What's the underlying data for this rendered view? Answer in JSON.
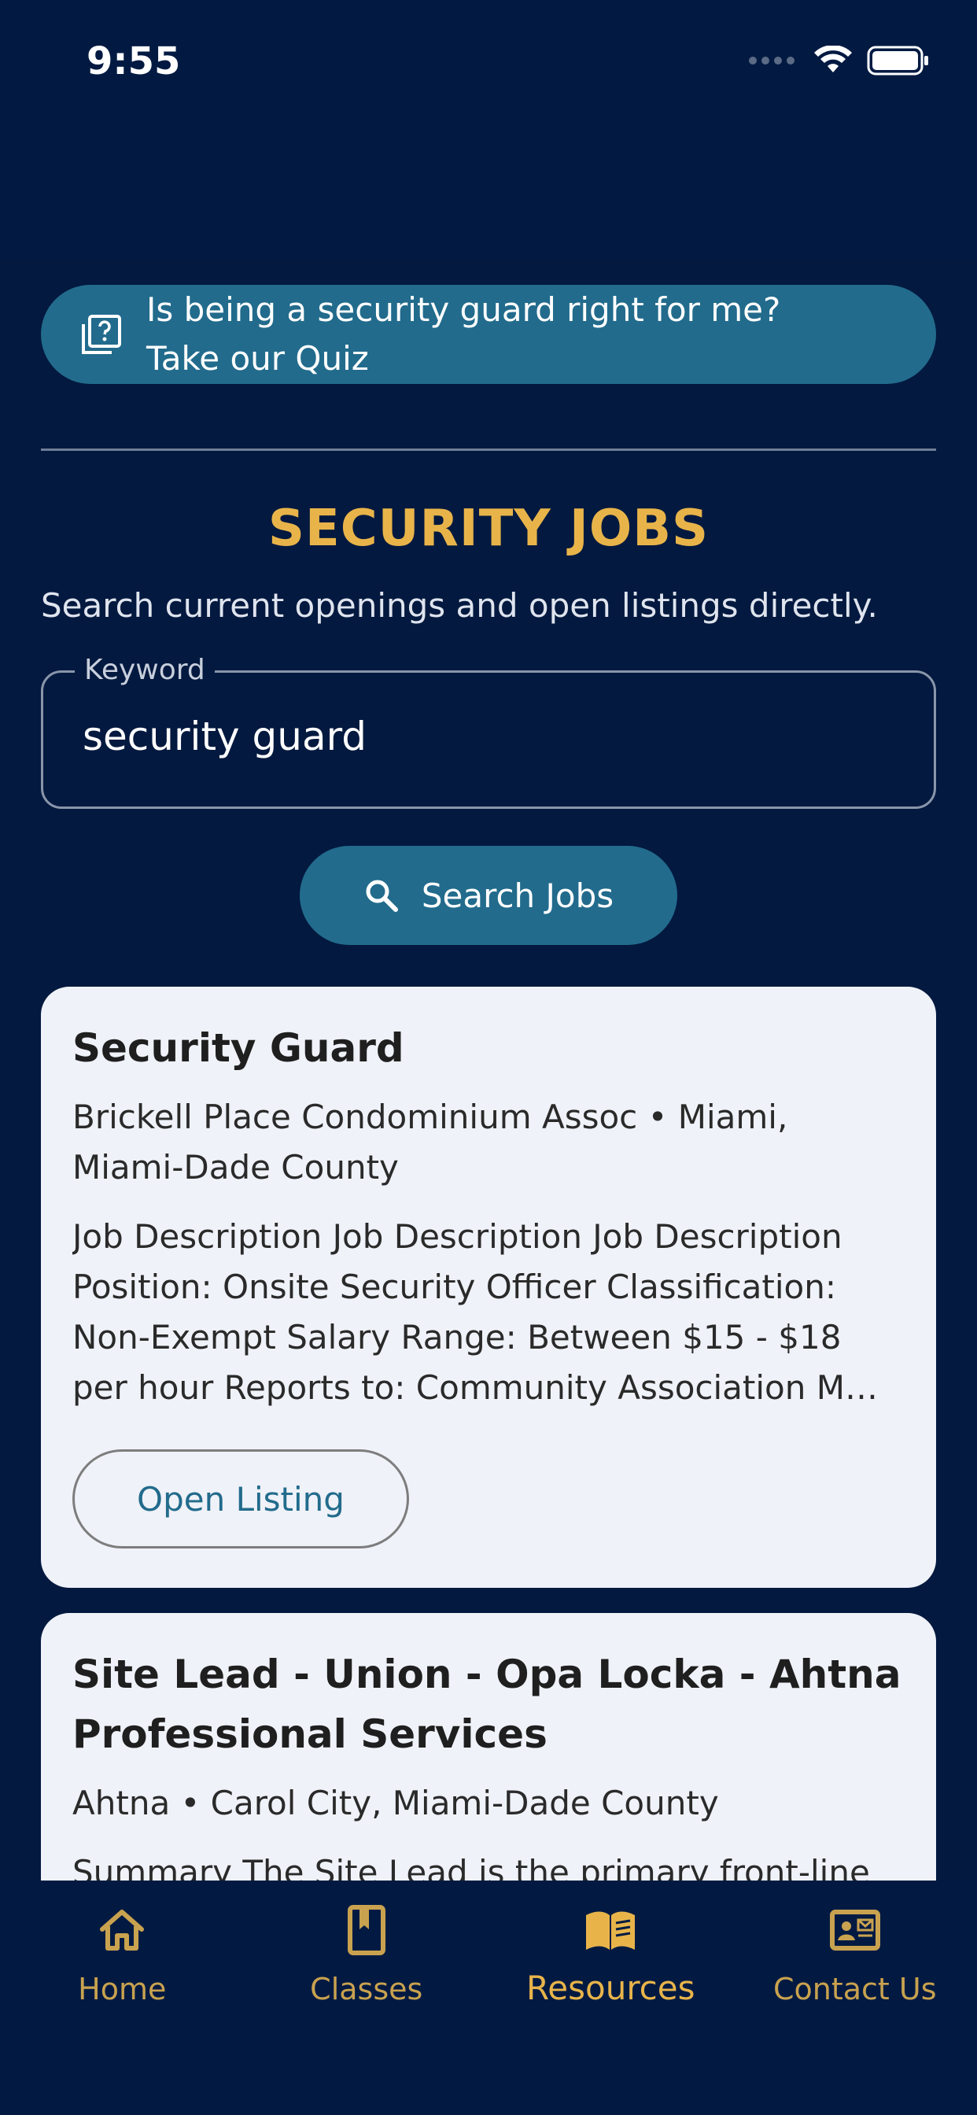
{
  "status_bar": {
    "time": "9:55"
  },
  "quiz_banner": {
    "line1": "Is being a security guard right for me?",
    "line2": "Take our Quiz",
    "icon": "quiz-icon"
  },
  "jobs": {
    "title": "SECURITY JOBS",
    "subtitle": "Search current openings and open listings directly.",
    "keyword_label": "Keyword",
    "keyword_value": "security guard",
    "search_label": "Search Jobs",
    "open_listing_label": "Open Listing",
    "listings": [
      {
        "title": "Security Guard",
        "meta": "Brickell Place Condominium Assoc • Miami, Miami-Dade County",
        "description": "Job Description Job Description Job Description Position: Onsite Security Officer Classification: Non-Exempt Salary Range: Between $15 - $18 per hour Reports to: Community Association M…"
      },
      {
        "title": "Site Lead - Union - Opa Locka - Ahtna Professional Services",
        "meta": "Ahtna • Carol City, Miami-Dade County",
        "description": "Summary The Site Lead is the primary front-line"
      }
    ]
  },
  "bottom_nav": {
    "items": [
      {
        "label": "Home",
        "icon": "home-icon"
      },
      {
        "label": "Classes",
        "icon": "book-icon"
      },
      {
        "label": "Resources",
        "icon": "open-book-icon",
        "active": true
      },
      {
        "label": "Contact Us",
        "icon": "contact-card-icon"
      }
    ]
  },
  "colors": {
    "background": "#021a42",
    "accent_blue": "#226b8c",
    "gold": "#e8b44a",
    "card": "#eff2f8"
  }
}
